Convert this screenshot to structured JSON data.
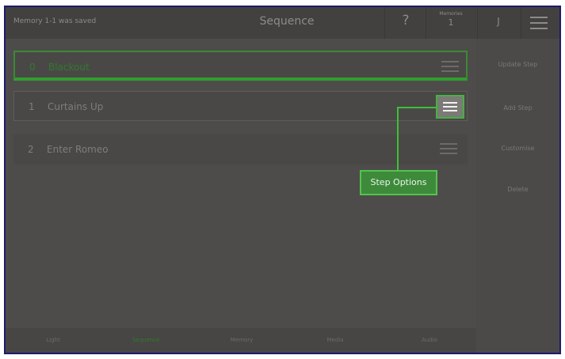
{
  "header": {
    "status_message": "Memory 1-1 was saved",
    "title": "Sequence",
    "help_label": "?",
    "memories_label": "Memories",
    "memories_count": "1",
    "user_initial": "J",
    "menu_icon": "hamburger-icon"
  },
  "steps": [
    {
      "number": "0",
      "name": "Blackout",
      "handle_icon": "hamburger-icon"
    },
    {
      "number": "1",
      "name": "Curtains Up",
      "handle_icon": "hamburger-icon"
    },
    {
      "number": "2",
      "name": "Enter Romeo",
      "handle_icon": "hamburger-icon"
    }
  ],
  "sidebar": {
    "items": [
      {
        "label": "Update Step"
      },
      {
        "label": "Add Step"
      },
      {
        "label": "Customise"
      },
      {
        "label": "Delete"
      }
    ]
  },
  "callout": {
    "label": "Step Options"
  },
  "bottom_tabs": [
    {
      "label": "Light"
    },
    {
      "label": "Sequence"
    },
    {
      "label": "Memory"
    },
    {
      "label": "Media"
    },
    {
      "label": "Audio"
    }
  ],
  "colors": {
    "accent_green": "#3bc234",
    "active_text": "#2f7a2c",
    "frame_border": "#1d1a6e"
  }
}
